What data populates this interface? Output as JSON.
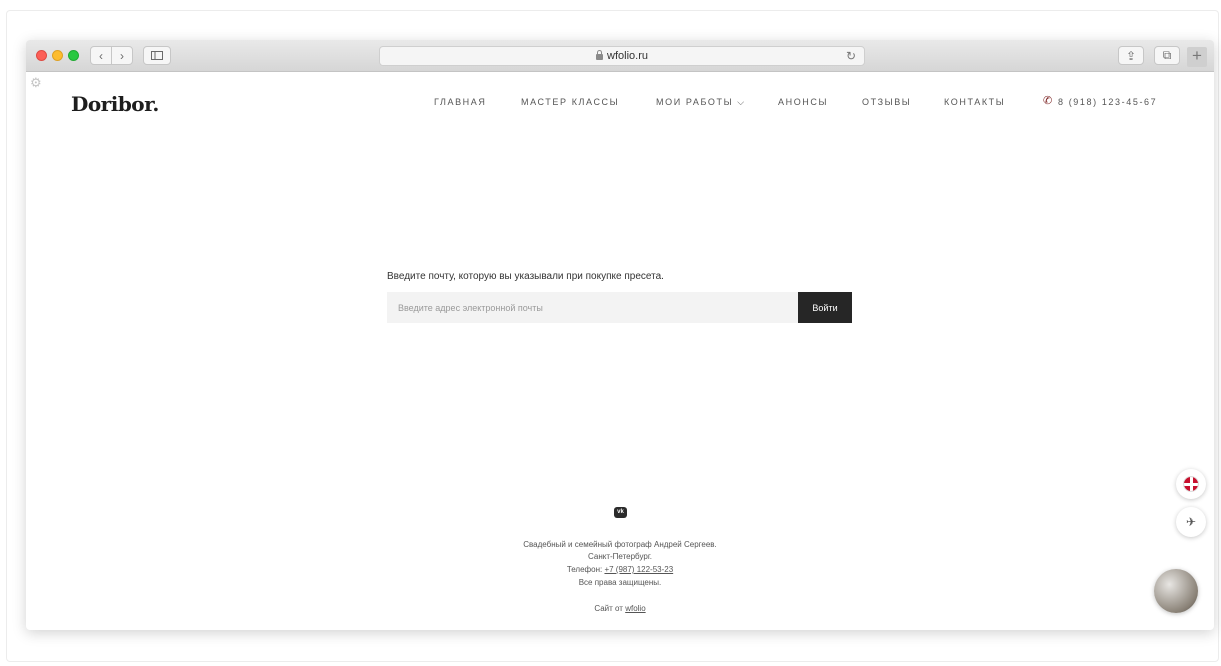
{
  "browser": {
    "url": "wfolio.ru",
    "back_glyph": "‹",
    "forward_glyph": "›",
    "reload_glyph": "↻",
    "share_glyph": "⇪",
    "tabs_glyph": "⧉",
    "newtab_glyph": "+"
  },
  "site": {
    "logo": "Doribor.",
    "nav": {
      "home": "ГЛАВНАЯ",
      "workshops": "МАСТЕР КЛАССЫ",
      "works": "МОИ РАБОТЫ ⌵",
      "announcements": "АНОНСЫ",
      "reviews": "ОТЗЫВЫ",
      "contacts": "КОНТАКТЫ",
      "phone": "8 (918) 123-45-67"
    },
    "phone_icon_color": "#7a1f1f"
  },
  "login": {
    "prompt": "Введите почту, которую вы указывали при покупке пресета.",
    "placeholder": "Введите адрес электронной почты",
    "button": "Войти"
  },
  "footer": {
    "vk_label": "vk",
    "line1": "Свадебный и семейный фотограф Андрей Сергеев.",
    "line2": "Санкт-Петербург.",
    "phone_prefix": "Телефон: ",
    "phone": "+7 (987) 122-53-23",
    "line4": "Все права защищены.",
    "credit_prefix": "Сайт от ",
    "credit_link": "wfolio"
  },
  "widgets": {
    "lang_icon": "uk-flag-icon",
    "send_glyph": "✈"
  }
}
